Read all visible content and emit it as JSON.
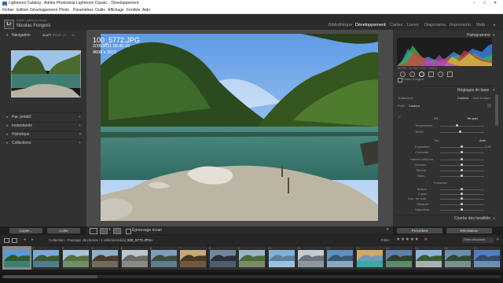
{
  "window": {
    "title": "Lightroom Catalog - Adobe Photoshop Lightroom Classic - Développement"
  },
  "menu": [
    "Fichier",
    "Edition",
    "Développement",
    "Photo",
    "Paramètres",
    "Outils",
    "Affichage",
    "Fenêtre",
    "Aide"
  ],
  "identity": {
    "app_name": "Adobe Lightroom Classic",
    "user_name": "Nicolas Fongoni",
    "logo": "Lr"
  },
  "modules": [
    {
      "label": "Bibliothèque",
      "active": false
    },
    {
      "label": "Développement",
      "active": true
    },
    {
      "label": "Cartes",
      "active": false
    },
    {
      "label": "Livres",
      "active": false
    },
    {
      "label": "Diaporama",
      "active": false
    },
    {
      "label": "Impression",
      "active": false
    },
    {
      "label": "Web",
      "active": false
    }
  ],
  "left_panel": {
    "navigator": {
      "title": "Navigation",
      "zoom_options": [
        "ADAPT",
        "REMPL",
        "1:1",
        "3:1"
      ]
    },
    "sections": [
      {
        "label": "Par. prédéf."
      },
      {
        "label": "Instantanés"
      },
      {
        "label": "Historique"
      },
      {
        "label": "Collections"
      }
    ],
    "buttons": {
      "copy": "Copier...",
      "paste": "Coller"
    }
  },
  "photo_info": {
    "filename": "100_5772.JPG",
    "datetime": "2/26/2011 09:40:10",
    "dimensions": "4608 x 3072"
  },
  "toolbar": {
    "soft_proof": "Épreuvage écran"
  },
  "right_panel": {
    "histogram": {
      "title": "Histogramme"
    },
    "original_photo": "Photo d'origine",
    "basic": {
      "title": "Réglages de base",
      "treatment_label": "Traitement :",
      "treatment_options": [
        "Couleur",
        "Noir et blanc"
      ],
      "profile_label": "Profil :",
      "profile_value": "Couleur",
      "wb_label": "BB :",
      "wb_value": "Tel quel",
      "sliders_group1": [
        "Température",
        "Teinte"
      ],
      "tone_label": "Ton",
      "auto": "Auto",
      "sliders_group2": [
        "Exposition",
        "Contraste",
        "Hautes lumières",
        "Ombres",
        "Blancs",
        "Noirs"
      ],
      "presence_label": "Présence",
      "sliders_group3": [
        "Texture",
        "Clarté",
        "Corr. du voile",
        "Vibrance",
        "Saturation"
      ],
      "exposition_value": "0,00",
      "more": "Courbe des tonalités"
    },
    "buttons": {
      "previous": "Précédent",
      "reset": "Réinitialiser"
    }
  },
  "filmbar": {
    "source_label": "Collection : Paysage",
    "count_text": "26 photos / 1 sélectionné(s) /",
    "selected_file": "100_5772.JPG",
    "filter_label": "Filtre :",
    "filter_value": "Filtres désactivés"
  },
  "filmstrip": {
    "count": 17,
    "selected_index": 0,
    "numbers": [
      "1",
      "2",
      "3",
      "4",
      "5",
      "6",
      "7",
      "8",
      "9",
      "10",
      "11",
      "12",
      "13",
      "14",
      "15",
      "16",
      "17"
    ]
  },
  "colors": {
    "accent_active": "#ffffff",
    "panel_bg": "#313131",
    "center_bg": "#4a4a4a",
    "film_selected": "#8a8a8a"
  }
}
